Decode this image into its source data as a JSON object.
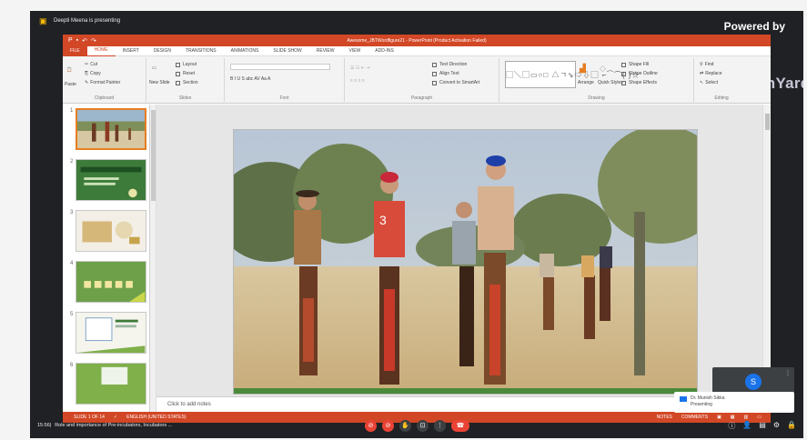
{
  "meet": {
    "presenting_text": "Deepti Meena is presenting",
    "powered_by": "Powered by",
    "streamyard": "StreamYard",
    "time": "15:56",
    "meeting_title": "Role and importance of Pre-incubators, Incubators ..."
  },
  "powerpoint": {
    "title": "Awesome_JBTWordfigure21 - PowerPoint (Product Activation Failed)",
    "tabs": [
      "FILE",
      "HOME",
      "INSERT",
      "DESIGN",
      "TRANSITIONS",
      "ANIMATIONS",
      "SLIDE SHOW",
      "REVIEW",
      "VIEW",
      "ADD-INS"
    ],
    "ribbon": {
      "clipboard": {
        "paste": "Paste",
        "cut": "Cut",
        "copy": "Copy",
        "format_painter": "Format Painter",
        "label": "Clipboard"
      },
      "slides": {
        "new_slide": "New Slide",
        "layout": "Layout",
        "reset": "Reset",
        "section": "Section",
        "label": "Slides"
      },
      "font": {
        "buttons": "B  I  U  S  abc  AV  Aa  A",
        "label": "Font"
      },
      "paragraph": {
        "text_direction": "Text Direction",
        "align_text": "Align Text",
        "convert_smartart": "Convert to SmartArt",
        "label": "Paragraph"
      },
      "drawing": {
        "arrange": "Arrange",
        "quick_styles": "Quick Styles",
        "shape_fill": "Shape Fill",
        "shape_outline": "Shape Outline",
        "shape_effects": "Shape Effects",
        "label": "Drawing"
      },
      "editing": {
        "find": "Find",
        "replace": "Replace",
        "select": "Select",
        "label": "Editing"
      }
    },
    "thumbnails": [
      "1",
      "2",
      "3",
      "4",
      "5",
      "6"
    ],
    "notes_placeholder": "Click to add notes",
    "status": {
      "slide_count": "SLIDE 1 OF 14",
      "language": "ENGLISH (UNITED STATES)",
      "notes": "NOTES",
      "comments": "COMMENTS"
    }
  },
  "participant": {
    "initial": "S",
    "popup_name": "Dr. Munish Sikka",
    "popup_status": "Presenting"
  },
  "colors": {
    "ppt_accent": "#d24726",
    "meet_bg": "#202124",
    "end_call": "#ea4335",
    "avatar": "#1a73e8"
  }
}
